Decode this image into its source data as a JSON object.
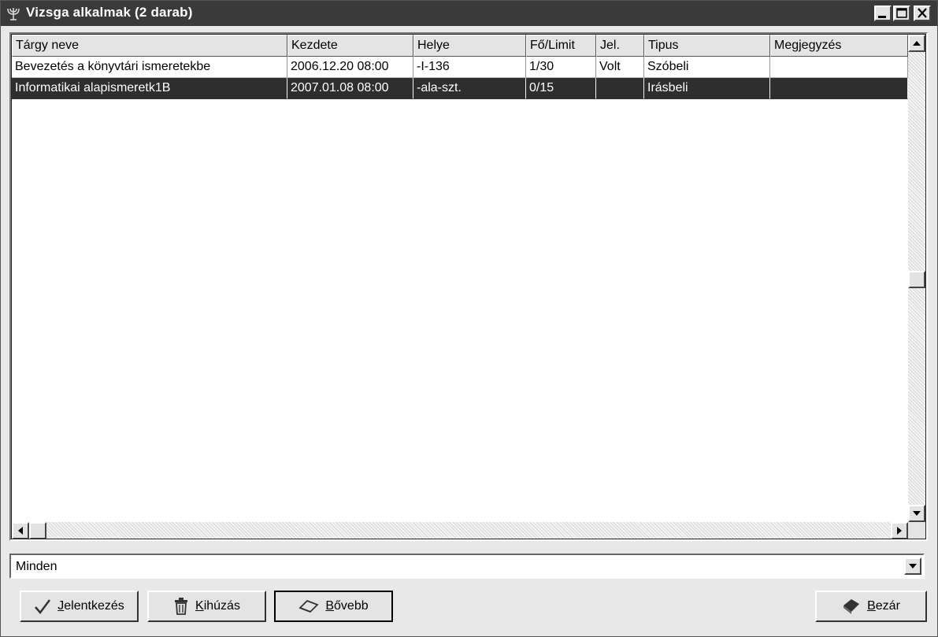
{
  "window": {
    "title": "Vizsga alkalmak (2 darab)"
  },
  "table": {
    "columns": [
      "Tárgy neve",
      "Kezdete",
      "Helye",
      "Fő/Limit",
      "Jel.",
      "Tipus",
      "Megjegyzés"
    ],
    "rows": [
      {
        "name": "Bevezetés a könyvtári ismeretekbe",
        "start": "2006.12.20 08:00",
        "place": "-I-136",
        "limit": "1/30",
        "jel": "Volt",
        "type": "Szóbeli",
        "note": "",
        "selected": false
      },
      {
        "name": "Informatikai alapismeretk1B",
        "start": "2007.01.08 08:00",
        "place": "-ala-szt.",
        "limit": "0/15",
        "jel": "",
        "type": "Irásbeli",
        "note": "",
        "selected": true
      }
    ]
  },
  "filter": {
    "value": "Minden"
  },
  "buttons": {
    "apply": "Jelentkezés",
    "remove": "Kihúzás",
    "more": "Bővebb",
    "close": "Bezár"
  },
  "icons": {
    "title": "menorah-icon",
    "apply": "checkmark-icon",
    "remove": "trash-icon",
    "more": "eraser-icon",
    "close": "book-icon"
  },
  "colors": {
    "titlebar": "#3a3a3a",
    "selection": "#2e2e2e",
    "face": "#e4e4e4"
  }
}
